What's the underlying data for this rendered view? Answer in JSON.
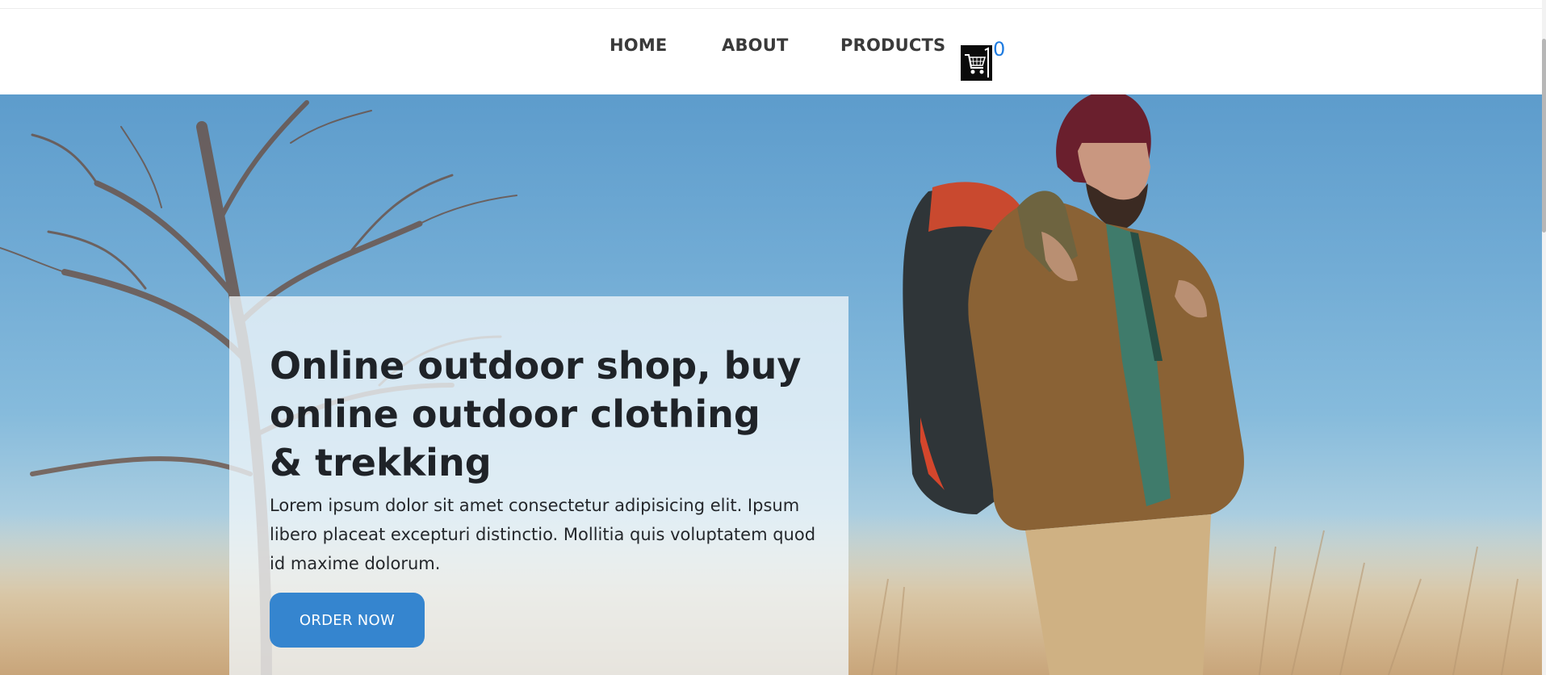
{
  "nav": {
    "links": [
      "HOME",
      "ABOUT",
      "PRODUCTS"
    ],
    "cart_count": "0",
    "cart_icon": "shopping-cart-icon",
    "cart_count_color": "#1e7be0"
  },
  "hero": {
    "title": "Online outdoor shop, buy online outdoor clothing & trekking",
    "text": "Lorem ipsum dolor sit amet consectetur adipisicing elit. Ipsum libero placeat excepturi distinctio. Mollitia quis voluptatem quod id maxime dolorum.",
    "button_label": "ORDER NOW",
    "button_color": "#3585cf",
    "background_image": "hiker-with-backpack-photo"
  }
}
